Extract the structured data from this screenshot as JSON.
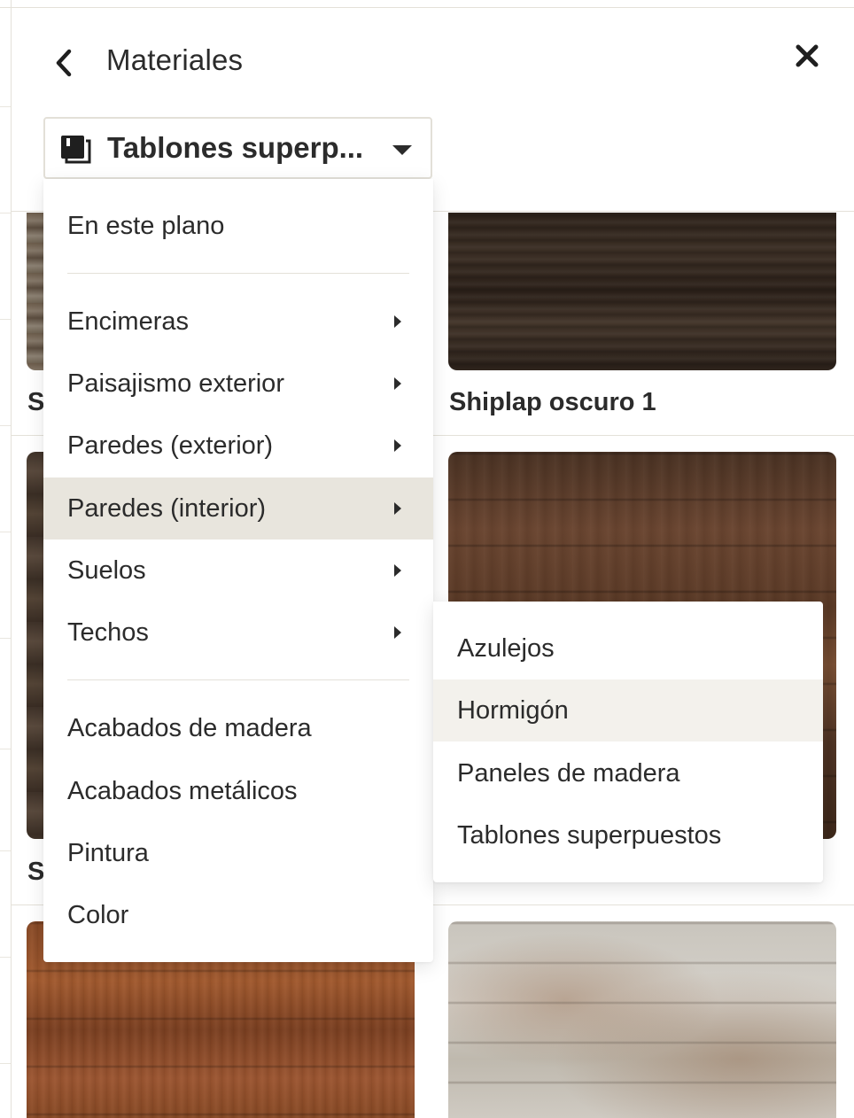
{
  "header": {
    "title": "Materiales"
  },
  "category_select": {
    "value": "Tablones superp...",
    "icon": "book-icon"
  },
  "cards": [
    {
      "label": "S"
    },
    {
      "label": "Shiplap oscuro 1"
    },
    {
      "label": "S"
    },
    {
      "label": ""
    },
    {
      "label": ""
    },
    {
      "label": ""
    }
  ],
  "menu": {
    "top_item": "En este plano",
    "groups": [
      {
        "label": "Encimeras",
        "has_submenu": true
      },
      {
        "label": "Paisajismo exterior",
        "has_submenu": true
      },
      {
        "label": "Paredes (exterior)",
        "has_submenu": true
      },
      {
        "label": "Paredes (interior)",
        "has_submenu": true,
        "active": true
      },
      {
        "label": "Suelos",
        "has_submenu": true
      },
      {
        "label": "Techos",
        "has_submenu": true
      }
    ],
    "finishes": [
      {
        "label": "Acabados de madera"
      },
      {
        "label": "Acabados metálicos"
      },
      {
        "label": "Pintura"
      },
      {
        "label": "Color"
      }
    ]
  },
  "submenu": {
    "items": [
      {
        "label": "Azulejos"
      },
      {
        "label": "Hormigón",
        "hover": true
      },
      {
        "label": "Paneles de madera"
      },
      {
        "label": "Tablones superpuestos"
      }
    ]
  },
  "colors": {
    "text": "#2b2b2b",
    "active_bg": "#e8e5dd",
    "hover_bg": "#f3f1ec",
    "border": "#e3e0d8"
  }
}
